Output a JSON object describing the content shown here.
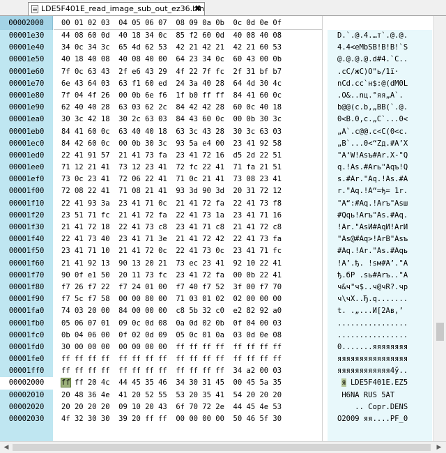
{
  "tab": {
    "title": "LDE5F401E_read_image_sub_out_ez36.bin",
    "close_glyph": "✖"
  },
  "header": {
    "offset_label": "00002000",
    "columns": "00 01 02 03  04 05 06 07  08 09 0a 0b  0c 0d 0e 0f"
  },
  "rows": [
    {
      "off": "00001e30",
      "hex": "44 08 60 0d  40 18 34 0c  85 f2 60 0d  40 08 40 08",
      "asc": "D.`.@.4.…т`.@.@."
    },
    {
      "off": "00001e40",
      "hex": "34 0c 34 3c  65 4d 62 53  42 21 42 21  42 21 60 53",
      "asc": "4.4<eMbSB!B!B!`S"
    },
    {
      "off": "00001e50",
      "hex": "40 18 40 08  40 08 40 00  64 23 34 0c  60 43 00 0b",
      "asc": "@.@.@.@.d#4.`C.."
    },
    {
      "off": "00001e60",
      "hex": "7f 0c 63 43  2f e6 43 29  4f 22 7f fc  2f 31 bf b7",
      "asc": ".cC/жC)O\"ь/1ї·"
    },
    {
      "off": "00001e70",
      "hex": "6e 43 64 03  63 f1 60 ed  24 3a 40 28  64 4d 30 4c",
      "asc": "nCd.cс`н$:@(dM0L"
    },
    {
      "off": "00001e80",
      "hex": "7f 04 4f 26  00 0b 6e f6  1f b0 ff ff  84 41 60 0c",
      "asc": ".O&..nц.°яя„A`."
    },
    {
      "off": "00001e90",
      "hex": "62 40 40 28  63 03 62 2c  84 42 42 28  60 0c 40 18",
      "asc": "b@@(c.b,„BB(`.@."
    },
    {
      "off": "00001ea0",
      "hex": "30 3c 42 18  30 2c 63 03  84 43 60 0c  00 0b 30 3c",
      "asc": "0<B.0,c.„C`...0<"
    },
    {
      "off": "00001eb0",
      "hex": "84 41 60 0c  63 40 40 18  63 3c 43 28  30 3c 63 03",
      "asc": "„A`.c@@.c<C(0<c."
    },
    {
      "off": "00001ec0",
      "hex": "84 42 60 0c  00 0b 30 3c  93 5a e4 00  23 41 92 58",
      "asc": "„B`...0<“Zд.#A’X"
    },
    {
      "off": "00001ed0",
      "hex": "22 41 91 57  21 41 73 fa  23 41 72 16  d5 2d 22 51",
      "asc": "\"A‘W!Asъ#Ar.Х-\"Q"
    },
    {
      "off": "00001ee0",
      "hex": "71 12 21 41  73 12 23 41  72 fc 22 41  71 fa 21 51",
      "asc": "q.!As.#Arь\"Aqъ!Q"
    },
    {
      "off": "00001ef0",
      "hex": "73 0c 23 41  72 06 22 41  71 0c 21 41  73 08 23 41",
      "asc": "s.#Ar.\"Aq.!As.#A"
    },
    {
      "off": "00001f00",
      "hex": "72 08 22 41  71 08 21 41  93 3d 90 3d  20 31 72 12",
      "asc": "r.\"Aq.!A“=ђ= 1r."
    },
    {
      "off": "00001f10",
      "hex": "22 41 93 3a  23 41 71 0c  21 41 72 fa  22 41 73 f8",
      "asc": "\"A“:#Aq.!Arъ\"Asш"
    },
    {
      "off": "00001f20",
      "hex": "23 51 71 fc  21 41 72 fa  22 41 73 1a  23 41 71 16",
      "asc": "#Qqь!Arъ\"As.#Aq."
    },
    {
      "off": "00001f30",
      "hex": "21 41 72 18  22 41 73 c8  23 41 71 c8  21 41 72 c8",
      "asc": "!Ar.\"AsИ#AqИ!ArИ"
    },
    {
      "off": "00001f40",
      "hex": "22 41 73 40  23 41 71 3e  21 41 72 42  22 41 73 fa",
      "asc": "\"As@#Aq>!ArB\"Asъ"
    },
    {
      "off": "00001f50",
      "hex": "23 41 71 10  21 41 72 0c  22 41 73 0c  23 41 71 fc",
      "asc": "#Aq.!Ar.\"As.#Aqь"
    },
    {
      "off": "00001f60",
      "hex": "21 41 92 13  90 13 20 21  73 ec 23 41  92 10 22 41",
      "asc": "!A’.ђ. !sм#A’.\"A"
    },
    {
      "off": "00001f70",
      "hex": "90 0f e1 50  20 11 73 fc  23 41 72 fa  00 0b 22 41",
      "asc": "ђ.бP .sь#Arъ..\"A"
    },
    {
      "off": "00001f80",
      "hex": "f7 26 f7 22  f7 24 01 00  f7 40 f7 52  3f 00 f7 70",
      "asc": "ч&ч\"ч$..ч@чR?.чp"
    },
    {
      "off": "00001f90",
      "hex": "f7 5c f7 58  00 00 80 00  71 03 01 02  02 00 00 00",
      "asc": "ч\\чX..Ђ.q......."
    },
    {
      "off": "00001fa0",
      "hex": "74 03 20 00  84 00 00 00  c8 5b 32 c0  e2 82 92 a0",
      "asc": "t. .„...И[2Ав‚’ "
    },
    {
      "off": "00001fb0",
      "hex": "05 06 07 01  09 0c 0d 08  0a 0d 02 0b  0f 04 00 03",
      "asc": "................"
    },
    {
      "off": "00001fc0",
      "hex": "0b 04 06 00  0f 02 0d 09  05 0c 01 0a  03 0d 0e 08",
      "asc": "................"
    },
    {
      "off": "00001fd0",
      "hex": "30 00 00 00  00 00 00 00  ff ff ff ff  ff ff ff ff",
      "asc": "0.......яяяяяяяя"
    },
    {
      "off": "00001fe0",
      "hex": "ff ff ff ff  ff ff ff ff  ff ff ff ff  ff ff ff ff",
      "asc": "яяяяяяяяяяяяяяяя"
    },
    {
      "off": "00001ff0",
      "hex": "ff ff ff ff  ff ff ff ff  ff ff ff ff  34 a2 00 03",
      "asc": "яяяяяяяяяяяя4ў.."
    },
    {
      "off": "00002000",
      "hex": "   ff 20 4c  44 45 35 46  34 30 31 45  00 45 5a 35",
      "asc": " я LDE5F401E.EZ5",
      "cursor": true,
      "cursor_byte": "ff"
    },
    {
      "off": "00002010",
      "hex": "20 48 36 4e  41 20 52 55  53 20 35 41  54 20 20 20",
      "asc": " H6NA RUS 5AT   "
    },
    {
      "off": "00002020",
      "hex": "20 20 20 20  09 10 20 43  6f 70 72 2e  44 45 4e 53",
      "asc": "    .. Copr.DENS"
    },
    {
      "off": "00002030",
      "hex": "4f 32 30 30  39 20 ff ff  00 00 00 00  50 46 5f 30",
      "asc": "O2009 яя....PF_0"
    }
  ],
  "colors": {
    "gutter": "#bfe6f1",
    "ascii_bg": "#e8f8fb",
    "cursor": "#9bb07a"
  }
}
